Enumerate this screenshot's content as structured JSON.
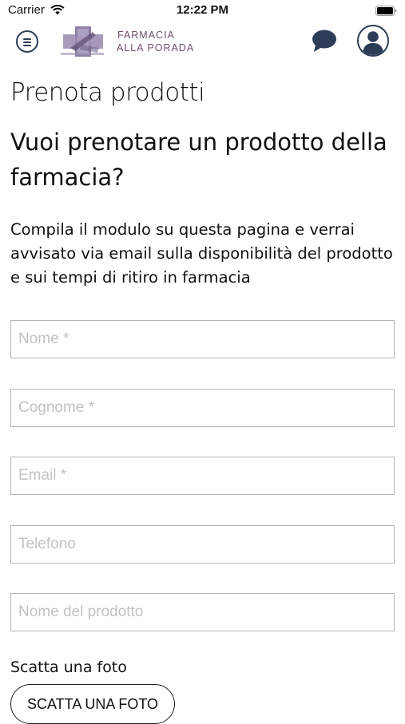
{
  "status_bar": {
    "carrier": "Carrier",
    "time": "12:22 PM"
  },
  "header": {
    "logo_line1": "FARMACIA",
    "logo_line2": "ALLA PORADA"
  },
  "page": {
    "title": "Prenota prodotti",
    "subtitle": "Vuoi prenotare un prodotto della farmacia?",
    "intro": "Compila il modulo su questa pagina e verrai avvisato via email sulla disponibilità del prodotto e sui tempi di ritiro in farmacia"
  },
  "form": {
    "nome_placeholder": "Nome *",
    "cognome_placeholder": "Cognome *",
    "email_placeholder": "Email *",
    "telefono_placeholder": "Telefono",
    "prodotto_placeholder": "Nome del prodotto",
    "photo_label": "Scatta una foto",
    "photo_button": "SCATTA UNA FOTO"
  },
  "colors": {
    "nav_icon": "#2c3e57",
    "logo_text": "#6e4f6a",
    "field_border": "#b5b5b5",
    "placeholder": "#c2c2c2"
  },
  "icons": [
    "wifi-icon",
    "battery-icon",
    "menu-icon",
    "logo-cross-icon",
    "chat-icon",
    "user-icon"
  ]
}
